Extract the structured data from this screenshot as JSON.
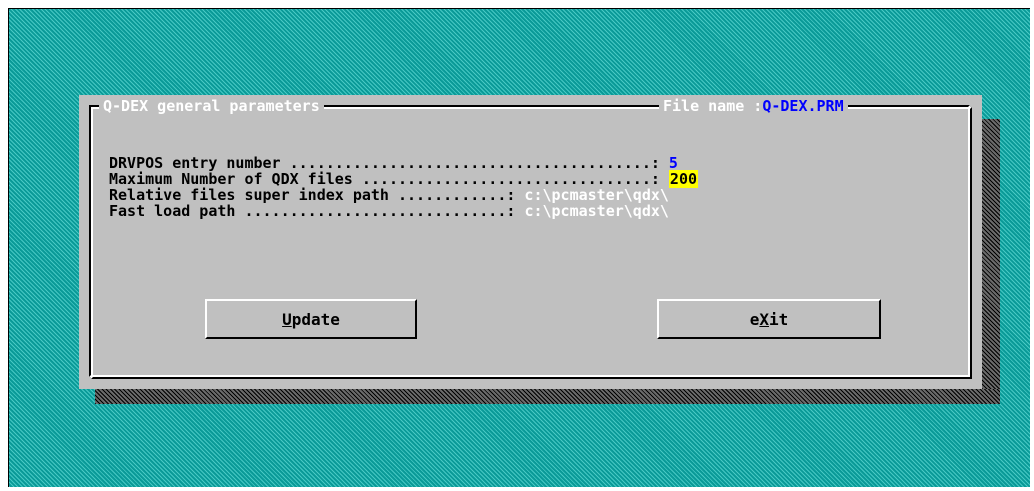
{
  "dialog": {
    "title": "Q-DEX general parameters",
    "file_label": "File name :",
    "file_name": "Q-DEX.PRM"
  },
  "fields": [
    {
      "label": "DRVPOS entry number ",
      "dots": "........................................: ",
      "value": "5"
    },
    {
      "label": "Maximum Number of QDX files ",
      "dots": "................................: ",
      "value": "200"
    },
    {
      "label": "Relative files super index path ",
      "dots": "............: ",
      "value": "c:\\pcmaster\\qdx\\"
    },
    {
      "label": "Fast load path ",
      "dots": ".............................: ",
      "value": "c:\\pcmaster\\qdx\\"
    }
  ],
  "buttons": {
    "update_hot": "U",
    "update_rest": "pdate",
    "exit_pre": "e",
    "exit_hot": "X",
    "exit_rest": "it"
  },
  "colors": {
    "background": "#0a9a98",
    "dialog": "#c0c0c0",
    "accent_blue": "#0000ff",
    "highlight": "#ffff00"
  }
}
